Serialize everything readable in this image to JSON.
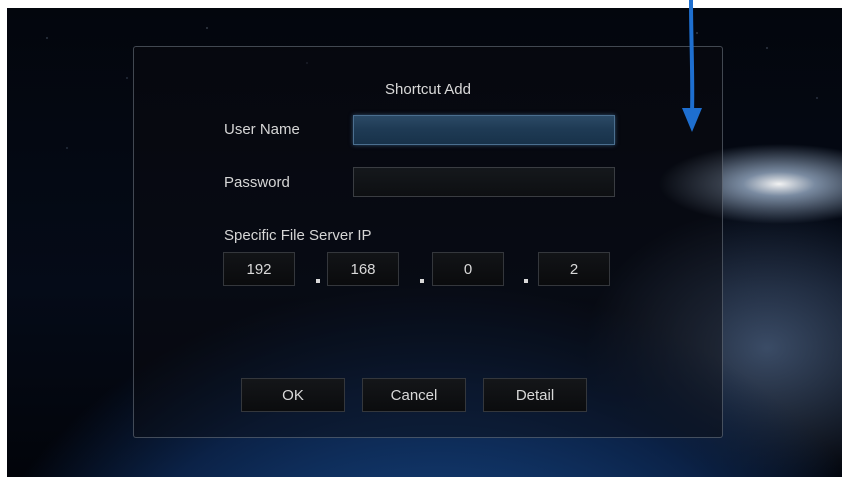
{
  "dialog": {
    "title": "Shortcut Add",
    "username_label": "User Name",
    "username_value": "",
    "password_label": "Password",
    "password_value": "",
    "ip_label": "Specific File Server IP",
    "ip_octets": [
      "192",
      "168",
      "0",
      "2"
    ],
    "ip_separator": ".",
    "buttons": {
      "ok": "OK",
      "cancel": "Cancel",
      "detail": "Detail"
    }
  },
  "annotation": {
    "arrow_color": "#1e6fd0"
  }
}
